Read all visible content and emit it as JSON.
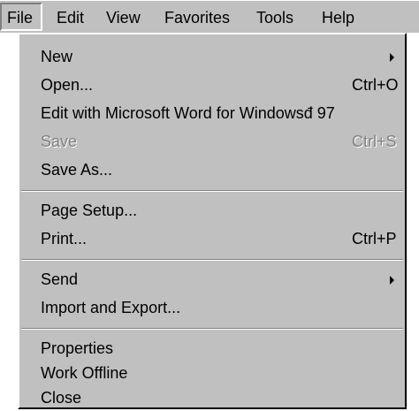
{
  "menubar": {
    "items": [
      "File",
      "Edit",
      "View",
      "Favorites",
      "Tools",
      "Help"
    ]
  },
  "file_menu": {
    "new": {
      "label": "New"
    },
    "open": {
      "label": "Open...",
      "shortcut": "Ctrl+O"
    },
    "edit_with_word": {
      "label": "Edit with Microsoft Word for Windowsđ 97"
    },
    "save": {
      "label": "Save",
      "shortcut": "Ctrl+S",
      "disabled": true
    },
    "save_as": {
      "label": "Save As..."
    },
    "page_setup": {
      "label": "Page Setup..."
    },
    "print": {
      "label": "Print...",
      "shortcut": "Ctrl+P"
    },
    "send": {
      "label": "Send"
    },
    "import_export": {
      "label": "Import and Export..."
    },
    "properties": {
      "label": "Properties"
    },
    "work_offline": {
      "label": "Work Offline"
    },
    "close": {
      "label": "Close"
    }
  },
  "colors": {
    "menu_face": "#c0c0c0",
    "disabled_text": "#808080",
    "highlight": "#ffffff",
    "shadow": "#808080"
  }
}
